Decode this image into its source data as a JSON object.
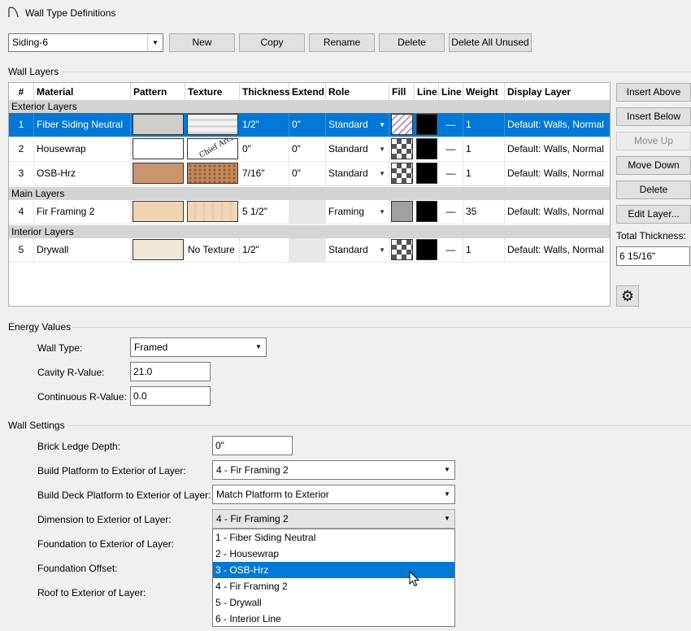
{
  "window": {
    "title": "Wall Type Definitions",
    "icon": "wall-arc-icon"
  },
  "toolbar": {
    "wall_type_value": "Siding-6",
    "new_label": "New",
    "copy_label": "Copy",
    "rename_label": "Rename",
    "delete_label": "Delete",
    "delete_unused_label": "Delete All Unused"
  },
  "wall_layers": {
    "section_label": "Wall Layers",
    "columns": [
      "#",
      "Material",
      "Pattern",
      "Texture",
      "Thickness",
      "Extend",
      "Role",
      "Fill",
      "Line",
      "Line",
      "Weight",
      "Display Layer"
    ],
    "groups": {
      "exterior": "Exterior Layers",
      "main": "Main Layers",
      "interior": "Interior Layers"
    },
    "rows": [
      {
        "num": "1",
        "material": "Fiber Siding Neutral",
        "pattern_color": "#cfcec9",
        "texture": "",
        "thickness": "1/2\"",
        "extend": "0\"",
        "role": "Standard",
        "line_style": "—",
        "weight": "1",
        "display_layer": "Default: Walls,  Normal",
        "selected": true
      },
      {
        "num": "2",
        "material": "Housewrap",
        "pattern_color": "#ffffff",
        "texture": "Chief Arch",
        "thickness": "0\"",
        "extend": "0\"",
        "role": "Standard",
        "line_style": "—",
        "weight": "1",
        "display_layer": "Default: Walls,  Normal"
      },
      {
        "num": "3",
        "material": "OSB-Hrz",
        "pattern_color": "#c8956e",
        "texture": "",
        "thickness": "7/16\"",
        "extend": "0\"",
        "role": "Standard",
        "line_style": "—",
        "weight": "1",
        "display_layer": "Default: Walls,  Normal"
      },
      {
        "num": "4",
        "material": "Fir Framing 2",
        "pattern_color": "#efd4b4",
        "texture": "",
        "thickness": "5 1/2\"",
        "extend": "",
        "role": "Framing",
        "line_style": "—",
        "weight": "35",
        "display_layer": "Default: Walls,  Normal"
      },
      {
        "num": "5",
        "material": "Drywall",
        "pattern_color": "#f0e7d9",
        "texture": "No Texture",
        "thickness": "1/2\"",
        "extend": "",
        "role": "Standard",
        "line_style": "—",
        "weight": "1",
        "display_layer": "Default: Walls,  Normal"
      }
    ]
  },
  "side_buttons": {
    "insert_above": "Insert Above",
    "insert_below": "Insert Below",
    "move_up": "Move Up",
    "move_down": "Move Down",
    "delete": "Delete",
    "edit_layer": "Edit Layer...",
    "total_thickness_label": "Total Thickness:",
    "total_thickness_value": "6 15/16\"",
    "settings_icon": "gear-icon"
  },
  "energy": {
    "section_label": "Energy Values",
    "wall_type_label": "Wall Type:",
    "wall_type_value": "Framed",
    "cavity_label": "Cavity R-Value:",
    "cavity_value": "21.0",
    "continuous_label": "Continuous R-Value:",
    "continuous_value": "0.0"
  },
  "wall_settings": {
    "section_label": "Wall Settings",
    "brick_ledge_label": "Brick Ledge Depth:",
    "brick_ledge_value": "0\"",
    "build_platform_label": "Build Platform to Exterior of Layer:",
    "build_platform_value": "4 - Fir Framing 2",
    "build_deck_label": "Build Deck Platform to Exterior of Layer:",
    "build_deck_value": "Match Platform to Exterior",
    "dimension_label": "Dimension to Exterior of Layer:",
    "dimension_value": "4 - Fir Framing 2",
    "foundation_label": "Foundation to Exterior of Layer:",
    "foundation_offset_label": "Foundation Offset:",
    "roof_label": "Roof to Exterior of Layer:"
  },
  "dropdown_options": [
    "1 - Fiber Siding Neutral",
    "2 - Housewrap",
    "3 - OSB-Hrz",
    "4 - Fir Framing 2",
    "5 - Drywall",
    "6 - Interior Line"
  ],
  "dropdown_highlighted": "3 - OSB-Hrz",
  "colors": {
    "selection": "#0078d7",
    "group_header": "#d4d4d4"
  }
}
